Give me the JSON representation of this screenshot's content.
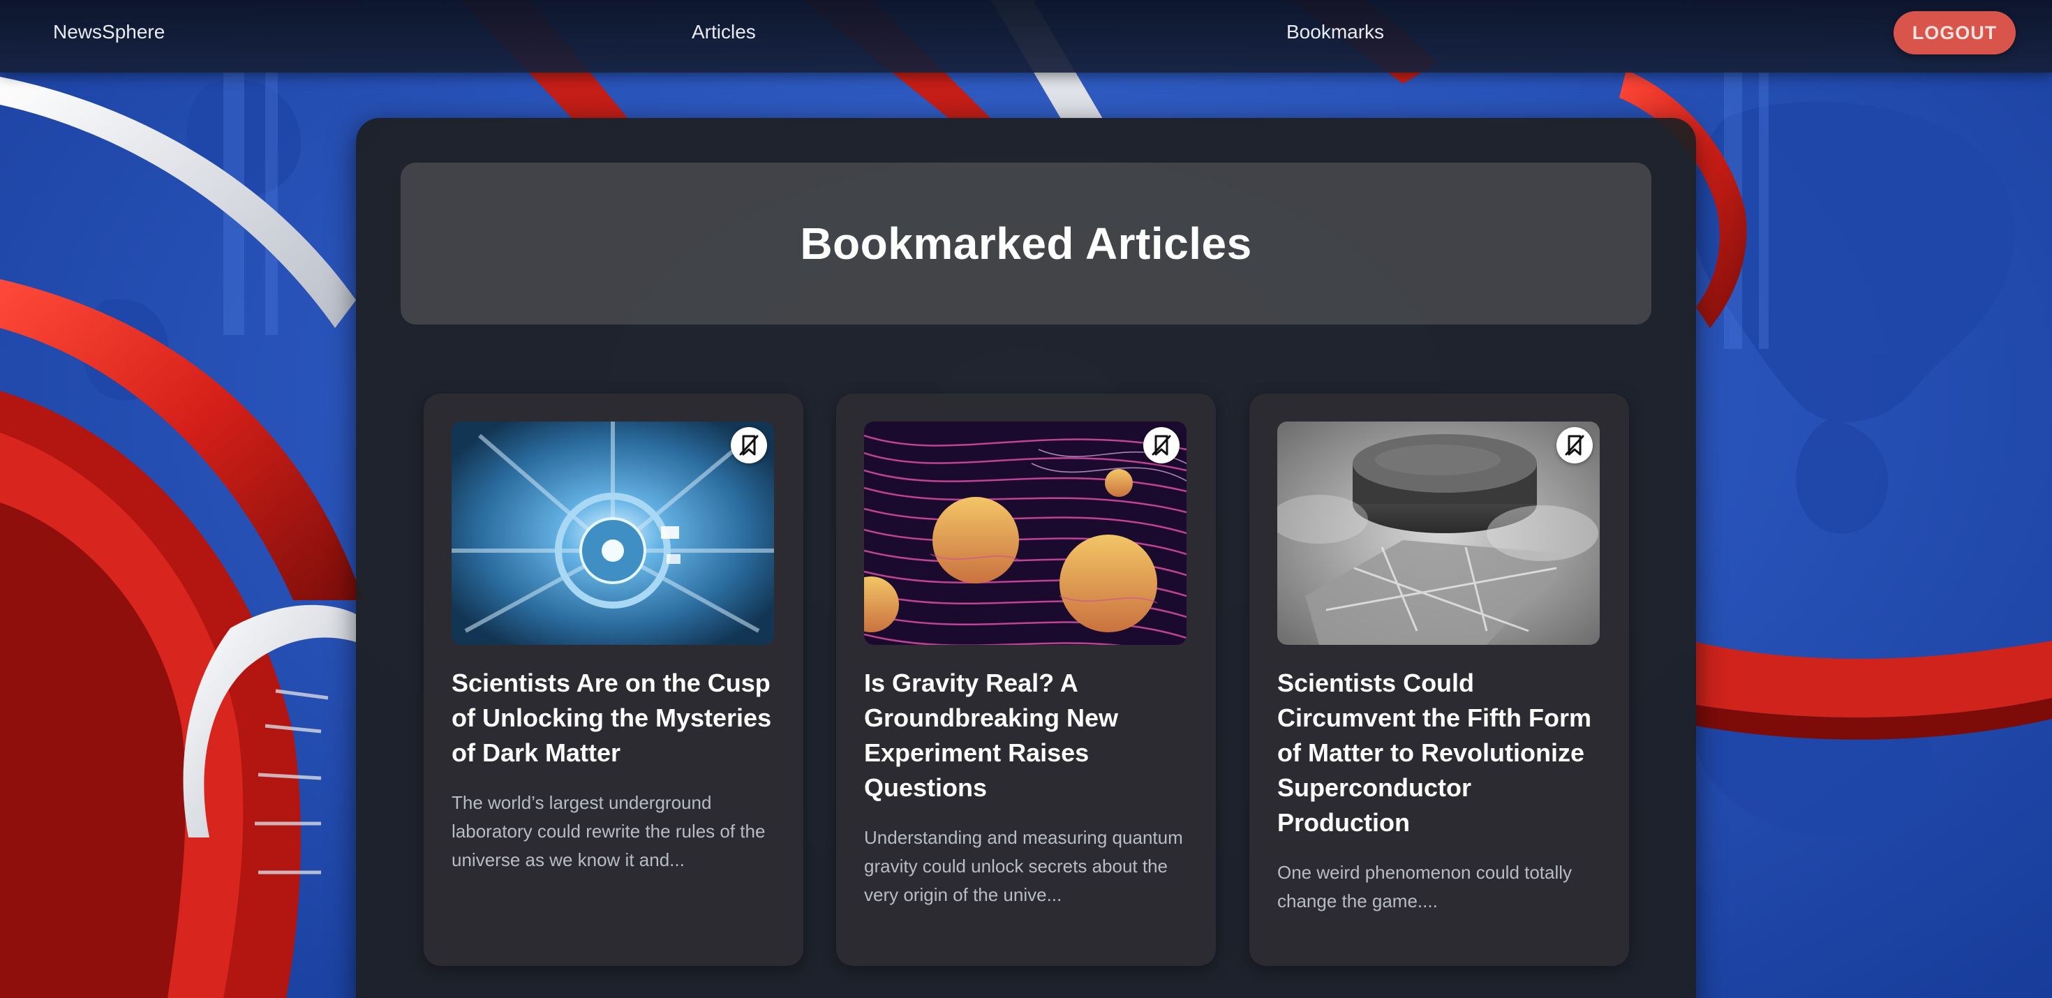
{
  "nav": {
    "brand": "NewsSphere",
    "articles_label": "Articles",
    "bookmarks_label": "Bookmarks",
    "logout_label": "LOGOUT"
  },
  "page": {
    "title": "Bookmarked Articles"
  },
  "articles": [
    {
      "title": "Scientists Are on the Cusp of Unlocking the Mysteries of Dark Matter",
      "excerpt": "The world’s largest underground laboratory could rewrite the rules of the universe as we know it and...",
      "image_icon": "particle-detector-image",
      "bookmarked": true
    },
    {
      "title": "Is Gravity Real? A Groundbreaking New Experiment Raises Questions",
      "excerpt": "Understanding and measuring quantum gravity could unlock secrets about the very origin of the unive...",
      "image_icon": "gravity-waves-planets-image",
      "bookmarked": true
    },
    {
      "title": "Scientists Could Circumvent the Fifth Form of Matter to Revolutionize Superconductor Production",
      "excerpt": "One weird phenomenon could totally change the game....",
      "image_icon": "superconductor-disc-image",
      "bookmarked": true
    }
  ],
  "colors": {
    "logout_bg": "#d9544a",
    "panel_bg": "#1e1f22",
    "background_blue": "#2b56b8",
    "ribbon_red": "#d8261f"
  }
}
